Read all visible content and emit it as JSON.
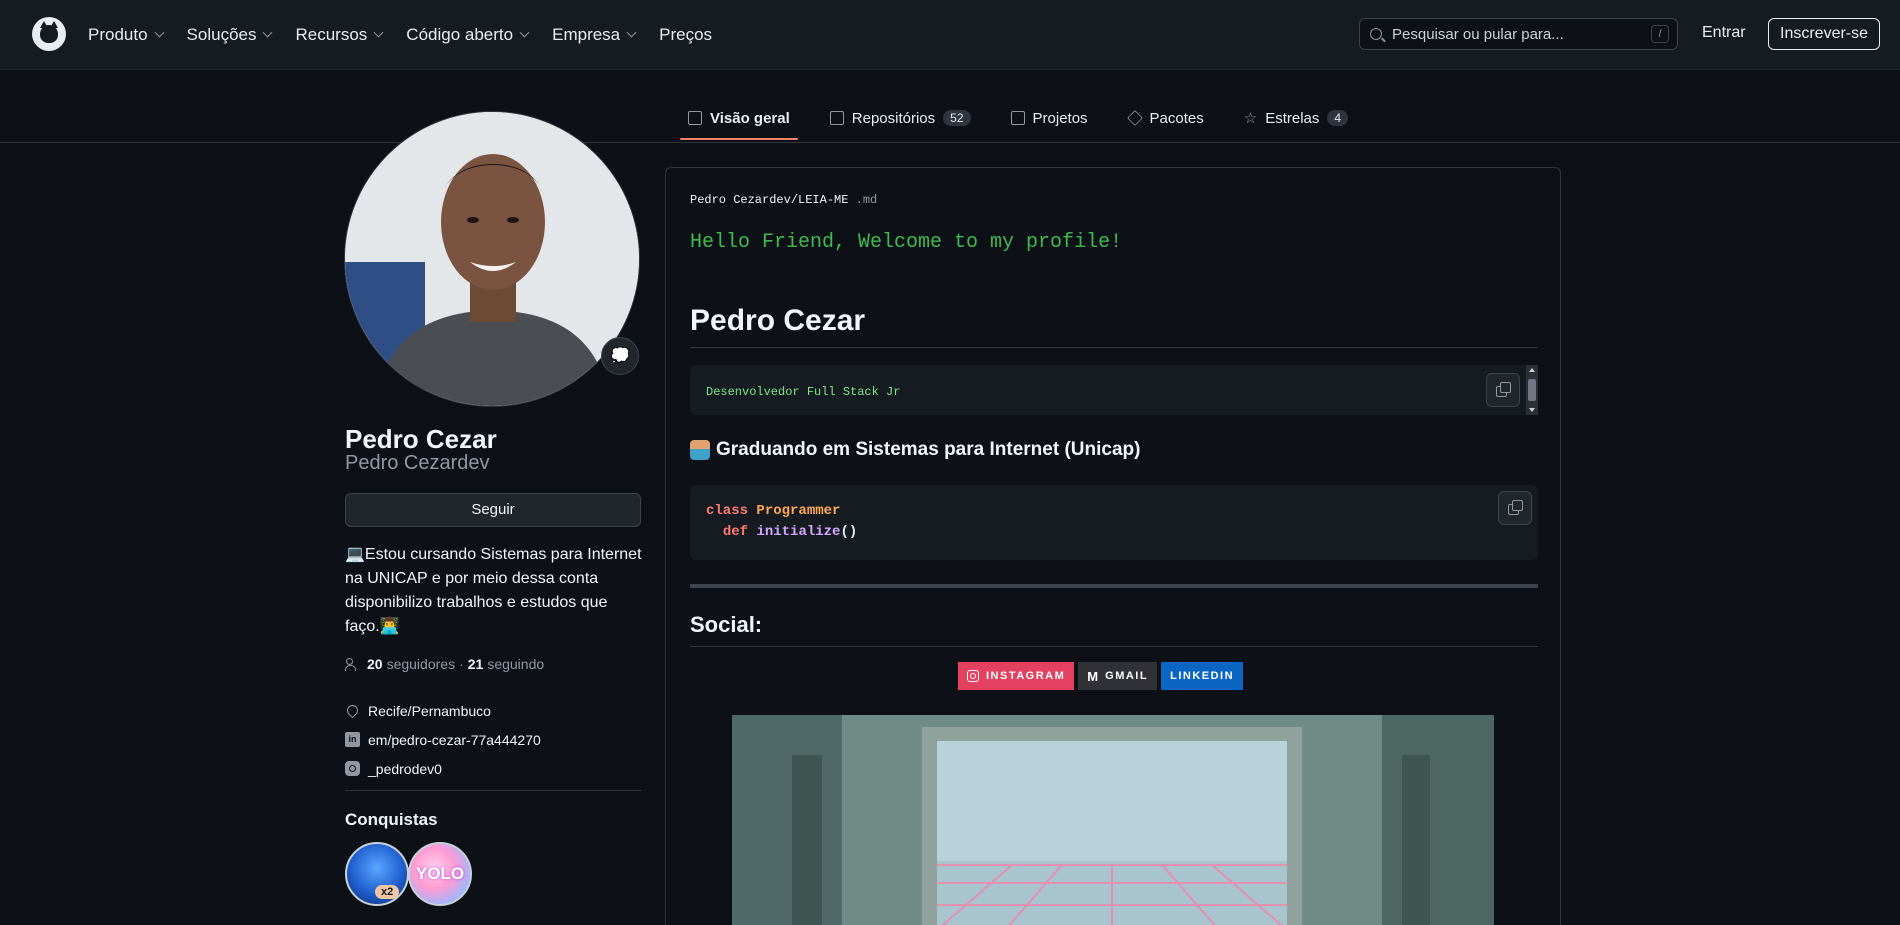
{
  "header": {
    "nav": [
      "Produto",
      "Soluções",
      "Recursos",
      "Código aberto",
      "Empresa",
      "Preços"
    ],
    "search_placeholder": "Pesquisar ou pular para...",
    "search_shortcut": "/",
    "signin": "Entrar",
    "signup": "Inscrever-se"
  },
  "tabs": [
    {
      "label": "Visão geral",
      "count": null,
      "active": true
    },
    {
      "label": "Repositórios",
      "count": "52"
    },
    {
      "label": "Projetos",
      "count": null
    },
    {
      "label": "Pacotes",
      "count": null
    },
    {
      "label": "Estrelas",
      "count": "4"
    }
  ],
  "profile": {
    "name": "Pedro Cezar",
    "username": "Pedro Cezardev",
    "follow_label": "Seguir",
    "bio": "💻Estou cursando Sistemas para Internet na UNICAP e por meio dessa conta disponibilizo trabalhos e estudos que faço.👨‍💻",
    "followers_count": "20",
    "followers_label": "seguidores",
    "separator": "·",
    "following_count": "21",
    "following_label": "seguindo",
    "location": "Recife/Pernambuco",
    "linkedin": "em/pedro-cezar-77a444270",
    "instagram": "_pedrodev0",
    "achievements_title": "Conquistas",
    "badge_count": "x2",
    "yolo_text": "YOLO"
  },
  "readme": {
    "path_owner": "Pedro Cezardev",
    "path_sep": "/",
    "path_file": "LEIA-ME",
    "path_ext": ".md",
    "hello": "Hello Friend, Welcome to my profile!",
    "title": "Pedro Cezar",
    "role": "Desenvolvedor Full Stack Jr",
    "subtitle": "Graduando em Sistemas para Internet (Unicap)",
    "code": {
      "kw1": "class",
      "cls": "Programmer",
      "kw2": "def",
      "fn": "initialize",
      "parens": "()"
    },
    "social_title": "Social:",
    "socials": [
      "INSTAGRAM",
      "GMAIL",
      "LINKEDIN"
    ]
  },
  "colors": {
    "accent_tab": "#f78166",
    "instagram": "#e4405f",
    "linkedin": "#0a66c2",
    "hello_green": "#3fb950"
  }
}
